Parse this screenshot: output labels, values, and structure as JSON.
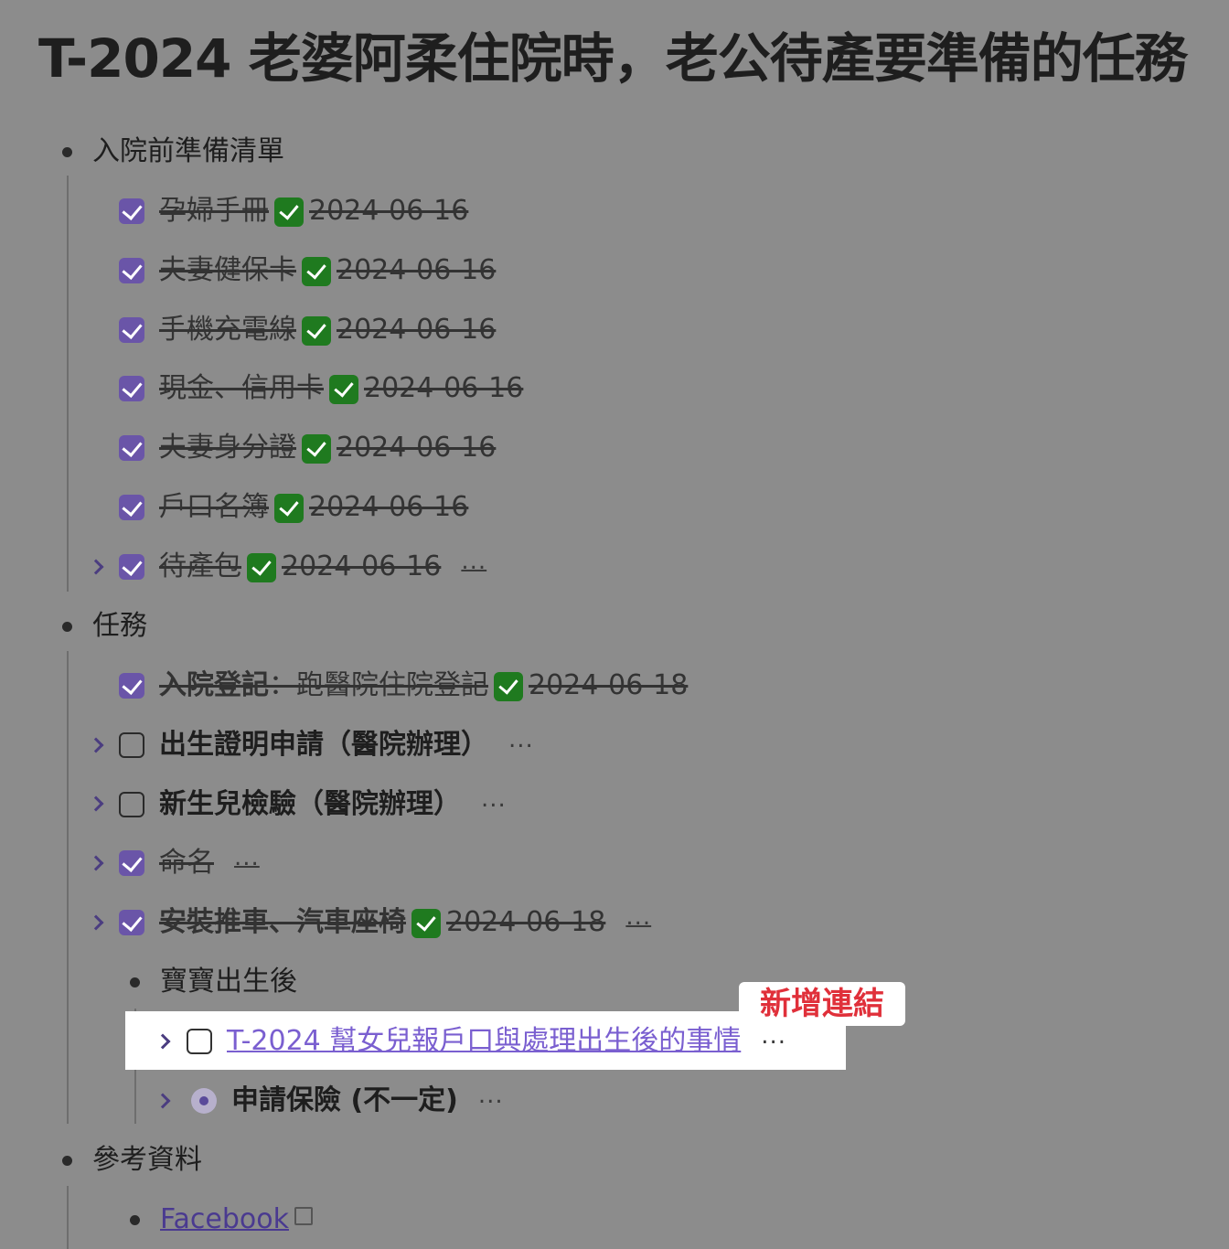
{
  "page_title": "T-2024 老婆阿柔住院時，老公待產要準備的任務",
  "sections": [
    {
      "label": "入院前準備清單",
      "items": [
        {
          "text": "孕婦手冊",
          "date": "2024-06-16"
        },
        {
          "text": "夫妻健保卡",
          "date": "2024-06-16"
        },
        {
          "text": "手機充電線",
          "date": "2024-06-16"
        },
        {
          "text": "現金、信用卡",
          "date": "2024-06-16"
        },
        {
          "text": "夫妻身分證",
          "date": "2024-06-16"
        },
        {
          "text": "戶口名簿",
          "date": "2024-06-16"
        },
        {
          "text": "待產包",
          "date": "2024-06-16",
          "more": "..."
        }
      ]
    },
    {
      "label": "任務",
      "items": [
        {
          "bold_text": "入院登記",
          "text": "：跑醫院住院登記",
          "date": "2024-06-18"
        },
        {
          "text": "出生證明申請（醫院辦理）",
          "more": "..."
        },
        {
          "text": "新生兒檢驗（醫院辦理）",
          "more": "..."
        },
        {
          "text": "命名",
          "more": "..."
        },
        {
          "text": "安裝推車、汽車座椅",
          "date": "2024-06-18",
          "more": "..."
        }
      ],
      "subsection": {
        "label": "寶寶出生後",
        "items": [
          {
            "text": "T-2024 幫女兒報戶口與處理出生後的事情",
            "more": "..."
          },
          {
            "text": "申請保險 (不一定)",
            "more": "..."
          }
        ]
      }
    },
    {
      "label": "參考資料",
      "items": [
        {
          "text": "Facebook"
        }
      ]
    }
  ],
  "annotation_badge": "新增連結",
  "colors": {
    "background": "#8c8c8c",
    "checkbox_accent": "#6a55a8",
    "done_icon": "#1f7a1f",
    "link": "#7a5fd0",
    "badge_text": "#e0303a"
  }
}
